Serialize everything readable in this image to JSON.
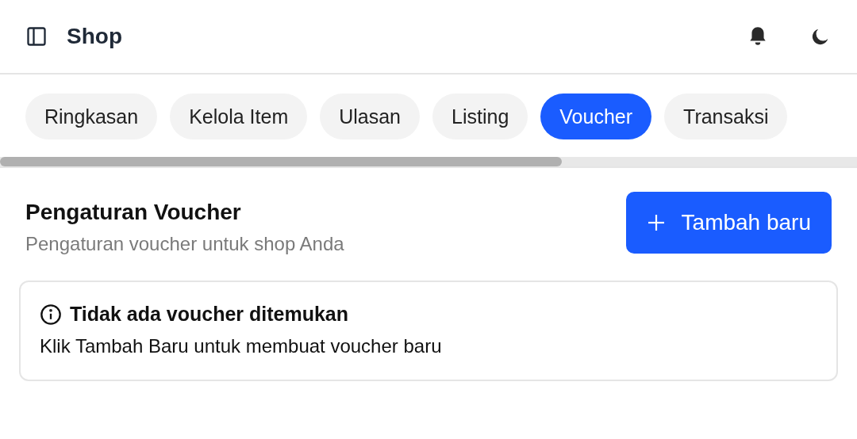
{
  "header": {
    "title": "Shop"
  },
  "tabs": [
    {
      "label": "Ringkasan",
      "selected": false
    },
    {
      "label": "Kelola Item",
      "selected": false
    },
    {
      "label": "Ulasan",
      "selected": false
    },
    {
      "label": "Listing",
      "selected": false
    },
    {
      "label": "Voucher",
      "selected": true
    },
    {
      "label": "Transaksi",
      "selected": false
    }
  ],
  "section": {
    "title": "Pengaturan Voucher",
    "subtitle": "Pengaturan voucher untuk shop Anda",
    "add_button": "Tambah baru"
  },
  "alert": {
    "title": "Tidak ada voucher ditemukan",
    "message": "Klik Tambah Baru untuk membuat voucher baru"
  }
}
